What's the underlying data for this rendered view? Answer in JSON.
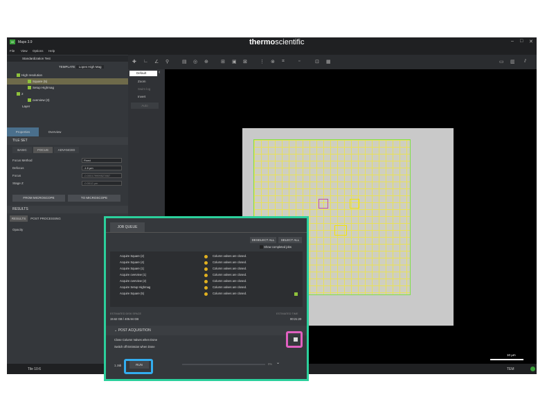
{
  "app": {
    "title": "Maps 3.9",
    "logo": "M",
    "brand_bold": "thermo",
    "brand_light": "scientific",
    "minimize": "–",
    "maximize": "□",
    "close": "✕"
  },
  "menu": [
    "File",
    "View",
    "Options",
    "Help"
  ],
  "project": {
    "name": "Standardization Test",
    "template_label": "TEMPLATE",
    "template_value": "Lopes High Mag"
  },
  "tree": [
    "High resolution",
    "Square (5)",
    "Setup Highmag",
    "2",
    "overview (3)",
    "Layer"
  ],
  "panel_tabs": {
    "properties": "Properties",
    "overview": "Overview"
  },
  "tile_set": {
    "header": "TILE SET",
    "tabs": [
      "BASIC",
      "FOCUS",
      "ADVANCED"
    ],
    "fields": [
      {
        "label": "Focus Method",
        "value": "Fixed"
      },
      {
        "label": "Defocus",
        "value": "-1.6 µm"
      },
      {
        "label": "Focus",
        "value": "-0.000179999527887"
      },
      {
        "label": "Stage Z",
        "value": "-0.0012 µm"
      }
    ],
    "from_btn": "FROM MICROSCOPE",
    "to_btn": "TO MICROSCOPE"
  },
  "results": {
    "header": "RESULTS",
    "tabs": [
      "RESULTS",
      "POST PROCESSING"
    ],
    "opacity": "Opacity"
  },
  "mid_panel": {
    "tab": "Default",
    "items": [
      "Zoom",
      "Swim log",
      "Invert",
      "Auto"
    ]
  },
  "job_queue": {
    "tab": "JOB QUEUE",
    "deselect": "DESELECT ALL",
    "select": "SELECT ALL",
    "show_completed": "Show completed jobs",
    "jobs": [
      {
        "name": "Acquire Square (2)",
        "status": "Column valves are closed."
      },
      {
        "name": "Acquire Square (4)",
        "status": "Column valves are closed."
      },
      {
        "name": "Acquire Square (1)",
        "status": "Column valves are closed."
      },
      {
        "name": "Acquire overview (1)",
        "status": "Column valves are closed."
      },
      {
        "name": "Acquire overview (2)",
        "status": "Column valves are closed."
      },
      {
        "name": "Acquire Setup Highmag",
        "status": "Column valves are closed."
      },
      {
        "name": "Acquire Square (5)",
        "status": "Column valves are closed."
      }
    ],
    "disk_label": "ESTIMATED DISK SPACE",
    "disk_value": "19.62 GB / 405.94 GB",
    "time_label": "ESTIMATED TIME",
    "time_value": "00:21:20",
    "post_header": "POST ACQUISITION",
    "post_items": [
      "Close Column Valves when Done",
      "Switch off Emission when Done"
    ],
    "jobs_count": "1 Job",
    "run": "RUN",
    "percent": "0%"
  },
  "status": {
    "tile": "Tile 10:6",
    "scale": "10 µm",
    "mode": "TEM"
  },
  "colors": {
    "accent": "#8fc23c",
    "queue_border": "#2bd09c",
    "highlight_pink": "#e060c0",
    "highlight_blue": "#33aef0"
  }
}
